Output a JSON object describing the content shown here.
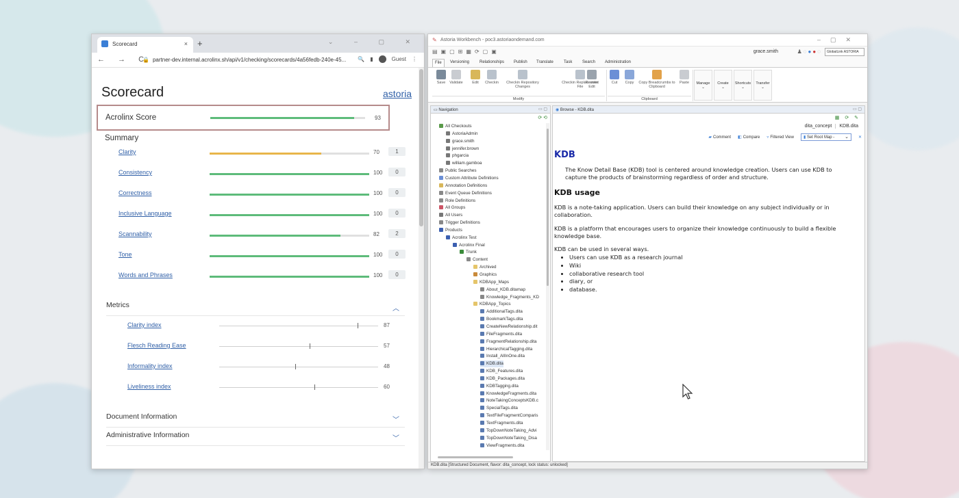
{
  "browser": {
    "tab_title": "Scorecard",
    "tab_close": "×",
    "new_tab": "+",
    "window_controls": "⌄ – ▢ ✕",
    "nav_buttons": "← → C",
    "url": "partner-dev.internal.acrolinx.sh/api/v1/checking/scorecards/4a56fedb-240e-45...",
    "profile_label": "Guest"
  },
  "scorecard": {
    "title": "Scorecard",
    "link": "astoria",
    "acrolinx_score": {
      "label": "Acrolinx Score",
      "value": "93",
      "fraction": 0.93
    },
    "summary_title": "Summary",
    "summary": [
      {
        "name": "Clarity",
        "value": "70",
        "issues": "1",
        "fraction": 0.7,
        "color": "#e8b54a"
      },
      {
        "name": "Consistency",
        "value": "100",
        "issues": "0",
        "fraction": 1.0,
        "color": "#5dbb7a"
      },
      {
        "name": "Correctness",
        "value": "100",
        "issues": "0",
        "fraction": 1.0,
        "color": "#5dbb7a"
      },
      {
        "name": "Inclusive Language",
        "value": "100",
        "issues": "0",
        "fraction": 1.0,
        "color": "#5dbb7a"
      },
      {
        "name": "Scannability",
        "value": "82",
        "issues": "2",
        "fraction": 0.82,
        "color": "#5dbb7a"
      },
      {
        "name": "Tone",
        "value": "100",
        "issues": "0",
        "fraction": 1.0,
        "color": "#5dbb7a"
      },
      {
        "name": "Words and Phrases",
        "value": "100",
        "issues": "0",
        "fraction": 1.0,
        "color": "#5dbb7a"
      }
    ],
    "metrics_title": "Metrics",
    "metrics": [
      {
        "name": "Clarity index",
        "value": "87",
        "fraction": 0.87
      },
      {
        "name": "Flesch Reading Ease",
        "value": "57",
        "fraction": 0.57
      },
      {
        "name": "Informality index",
        "value": "48",
        "fraction": 0.48
      },
      {
        "name": "Liveliness index",
        "value": "60",
        "fraction": 0.6
      }
    ],
    "doc_info": "Document Information",
    "admin_info": "Administrative Information"
  },
  "workbench": {
    "title": "Astoria Workbench - poc3.astoriaondemand.com",
    "user": "grace.smith",
    "logo": "GlobalLink ASTORIA",
    "menu": [
      "File",
      "Versioning",
      "Relationships",
      "Publish",
      "Translate",
      "Task",
      "Search",
      "Administration"
    ],
    "ribbon_modify": [
      {
        "label": "Save",
        "color": "#7a8a9a"
      },
      {
        "label": "Validate",
        "color": "#c9ccd1"
      },
      {
        "label": "Edit",
        "color": "#d8b75a"
      },
      {
        "label": "Checkin",
        "color": "#b9c2cc"
      },
      {
        "label": "Checkin Repository Changes",
        "color": "#b9c2cc"
      },
      {
        "label": "Checkin Replacement File",
        "color": "#b9c2cc"
      },
      {
        "label": "Revoke Edit",
        "color": "#9aa3ad"
      }
    ],
    "ribbon_clipboard": [
      {
        "label": "Cut",
        "color": "#6b8fd6"
      },
      {
        "label": "Copy",
        "color": "#8aa7d9"
      },
      {
        "label": "Copy Breadcrumbs to Clipboard",
        "color": "#e2a24a"
      },
      {
        "label": "Paste",
        "color": "#c9ccd1"
      }
    ],
    "group_modify": "Modify",
    "group_clipboard": "Clipboard",
    "ribbon_big": [
      "Manage",
      "Create",
      "Shortcuts",
      "Transfer"
    ],
    "nav_title": "Navigation",
    "browse_title": "Browse - KDB.dita",
    "tree": [
      {
        "label": "All Checkouts",
        "indent": 0,
        "color": "#5a9a4a"
      },
      {
        "label": "AstoriaAdmin",
        "indent": 1,
        "color": "#777"
      },
      {
        "label": "grace.smith",
        "indent": 1,
        "color": "#777"
      },
      {
        "label": "jennifer.brown",
        "indent": 1,
        "color": "#777"
      },
      {
        "label": "phgarcia",
        "indent": 1,
        "color": "#777"
      },
      {
        "label": "william.gamboa",
        "indent": 1,
        "color": "#777"
      },
      {
        "label": "Public Searches",
        "indent": 0,
        "color": "#888"
      },
      {
        "label": "Custom Attribute Definitions",
        "indent": 0,
        "color": "#6b8fd6"
      },
      {
        "label": "Annotation Definitions",
        "indent": 0,
        "color": "#d8b75a"
      },
      {
        "label": "Event Queue Definitions",
        "indent": 0,
        "color": "#888"
      },
      {
        "label": "Role Definitions",
        "indent": 0,
        "color": "#888"
      },
      {
        "label": "All Groups",
        "indent": 0,
        "color": "#c56"
      },
      {
        "label": "All Users",
        "indent": 0,
        "color": "#777"
      },
      {
        "label": "Trigger Definitions",
        "indent": 0,
        "color": "#888"
      },
      {
        "label": "Products",
        "indent": 0,
        "color": "#3b5fb0"
      },
      {
        "label": "Acrolinx Test",
        "indent": 1,
        "color": "#3b5fb0"
      },
      {
        "label": "Acrolinx Final",
        "indent": 2,
        "color": "#3b5fb0"
      },
      {
        "label": "Trunk",
        "indent": 3,
        "color": "#3a8b3a"
      },
      {
        "label": "Content",
        "indent": 4,
        "color": "#888"
      },
      {
        "label": "Archived",
        "indent": 5,
        "color": "#e5c56a"
      },
      {
        "label": "Graphics",
        "indent": 5,
        "color": "#c98a3a"
      },
      {
        "label": "KDBApp_Maps",
        "indent": 5,
        "color": "#e5c56a"
      },
      {
        "label": "About_KDB.ditamap",
        "indent": 6,
        "color": "#888"
      },
      {
        "label": "Knowledge_Fragments_KD",
        "indent": 6,
        "color": "#888"
      },
      {
        "label": "KDBApp_Topics",
        "indent": 5,
        "color": "#e5c56a"
      },
      {
        "label": "AdditionalTags.dita",
        "indent": 6,
        "color": "#5a7ab0"
      },
      {
        "label": "BookmarkTags.dita",
        "indent": 6,
        "color": "#5a7ab0"
      },
      {
        "label": "CreateNewRelationship.dit",
        "indent": 6,
        "color": "#5a7ab0"
      },
      {
        "label": "FileFragments.dita",
        "indent": 6,
        "color": "#5a7ab0"
      },
      {
        "label": "FragmentRelationship.dita",
        "indent": 6,
        "color": "#5a7ab0"
      },
      {
        "label": "HierarchicalTagging.dita",
        "indent": 6,
        "color": "#5a7ab0"
      },
      {
        "label": "Install_AllInOne.dita",
        "indent": 6,
        "color": "#5a7ab0"
      },
      {
        "label": "KDB.dita",
        "indent": 6,
        "color": "#5a7ab0",
        "selected": true
      },
      {
        "label": "KDB_Features.dita",
        "indent": 6,
        "color": "#5a7ab0"
      },
      {
        "label": "KDB_Packages.dita",
        "indent": 6,
        "color": "#5a7ab0"
      },
      {
        "label": "KDBTagging.dita",
        "indent": 6,
        "color": "#5a7ab0"
      },
      {
        "label": "KnowledgeFragments.dita",
        "indent": 6,
        "color": "#5a7ab0"
      },
      {
        "label": "NoteTakingConceptsKDB.c",
        "indent": 6,
        "color": "#5a7ab0"
      },
      {
        "label": "SpecialTags.dita",
        "indent": 6,
        "color": "#5a7ab0"
      },
      {
        "label": "TextFileFragmentComparis",
        "indent": 6,
        "color": "#5a7ab0"
      },
      {
        "label": "TextFragments.dita",
        "indent": 6,
        "color": "#5a7ab0"
      },
      {
        "label": "TopDownNoteTaking_Advi",
        "indent": 6,
        "color": "#5a7ab0"
      },
      {
        "label": "TopDownNoteTaking_Disa",
        "indent": 6,
        "color": "#5a7ab0"
      },
      {
        "label": "ViewFragments.dita",
        "indent": 6,
        "color": "#5a7ab0"
      }
    ],
    "breadcrumb": [
      "dita_concept",
      "KDB.dita"
    ],
    "actions": {
      "comment": "Comment",
      "compare": "Compare",
      "filtered": "Filtered View",
      "root_map": "Set Root Map -"
    },
    "doc": {
      "h1": "KDB",
      "p1": "The Know Detail Base (KDB) tool is centered around knowledge creation. Users can use KDB to capture the products of brainstorming regardless of order and structure.",
      "h2": "KDB usage",
      "p2": "KDB is a note-taking application. Users can build their knowledge on any subject individually or in collaboration.",
      "p3": "KDB is a platform that encourages users to organize their knowledge continuously to build a flexible knowledge base.",
      "p4": "KDB can be used in several ways.",
      "bullets": [
        "Users can use KDB as a research journal",
        "Wiki",
        "collaborative research tool",
        "diary, or",
        "database."
      ]
    },
    "status": "KDB.dita [Structured Document, flavor: dita_concept, lock status: unlocked]"
  }
}
